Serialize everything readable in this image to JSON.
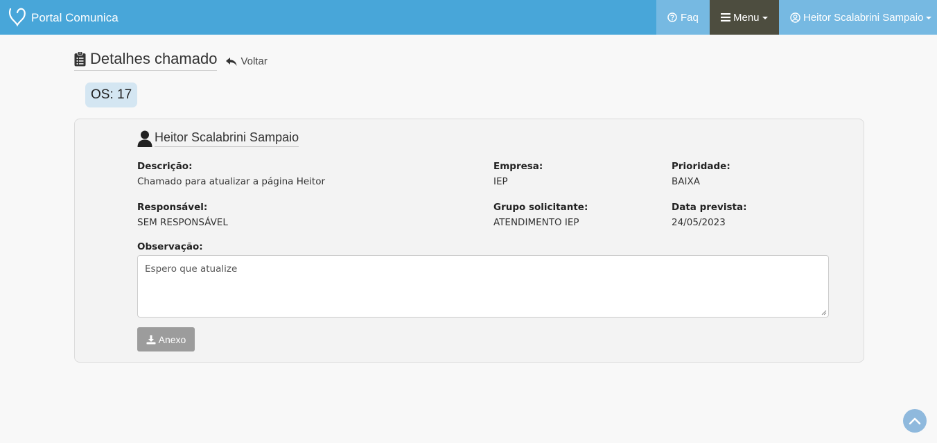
{
  "navbar": {
    "brand": "Portal Comunica",
    "faq_label": "Faq",
    "menu_label": "Menu",
    "user_label": "Heitor Scalabrini Sampaio"
  },
  "header": {
    "title": "Detalhes chamado",
    "back_label": "Voltar",
    "os_label": "OS: 17"
  },
  "details": {
    "user_name": "Heitor Scalabrini Sampaio",
    "descricao_label": "Descrição:",
    "descricao_value": "Chamado para atualizar a página Heitor",
    "empresa_label": "Empresa:",
    "empresa_value": "IEP",
    "prioridade_label": "Prioridade:",
    "prioridade_value": "BAIXA",
    "responsavel_label": "Responsável:",
    "responsavel_value": "SEM RESPONSÁVEL",
    "grupo_label": "Grupo solicitante:",
    "grupo_value": "ATENDIMENTO IEP",
    "data_label": "Data prevista:",
    "data_value": "24/05/2023",
    "observacao_label": "Observação:",
    "observacao_value": "Espero que atualize",
    "anexo_label": "Anexo"
  },
  "colors": {
    "navbar": "#48a6d9",
    "menu_active": "#4d4d3f",
    "badge": "#d4e6f2",
    "button_disabled": "#9c9c9c"
  },
  "icons": [
    "heart-logo-icon",
    "question-circle-icon",
    "bars-icon",
    "user-circle-icon",
    "clipboard-list-icon",
    "reply-icon",
    "user-icon",
    "download-icon",
    "chevron-up-icon"
  ]
}
